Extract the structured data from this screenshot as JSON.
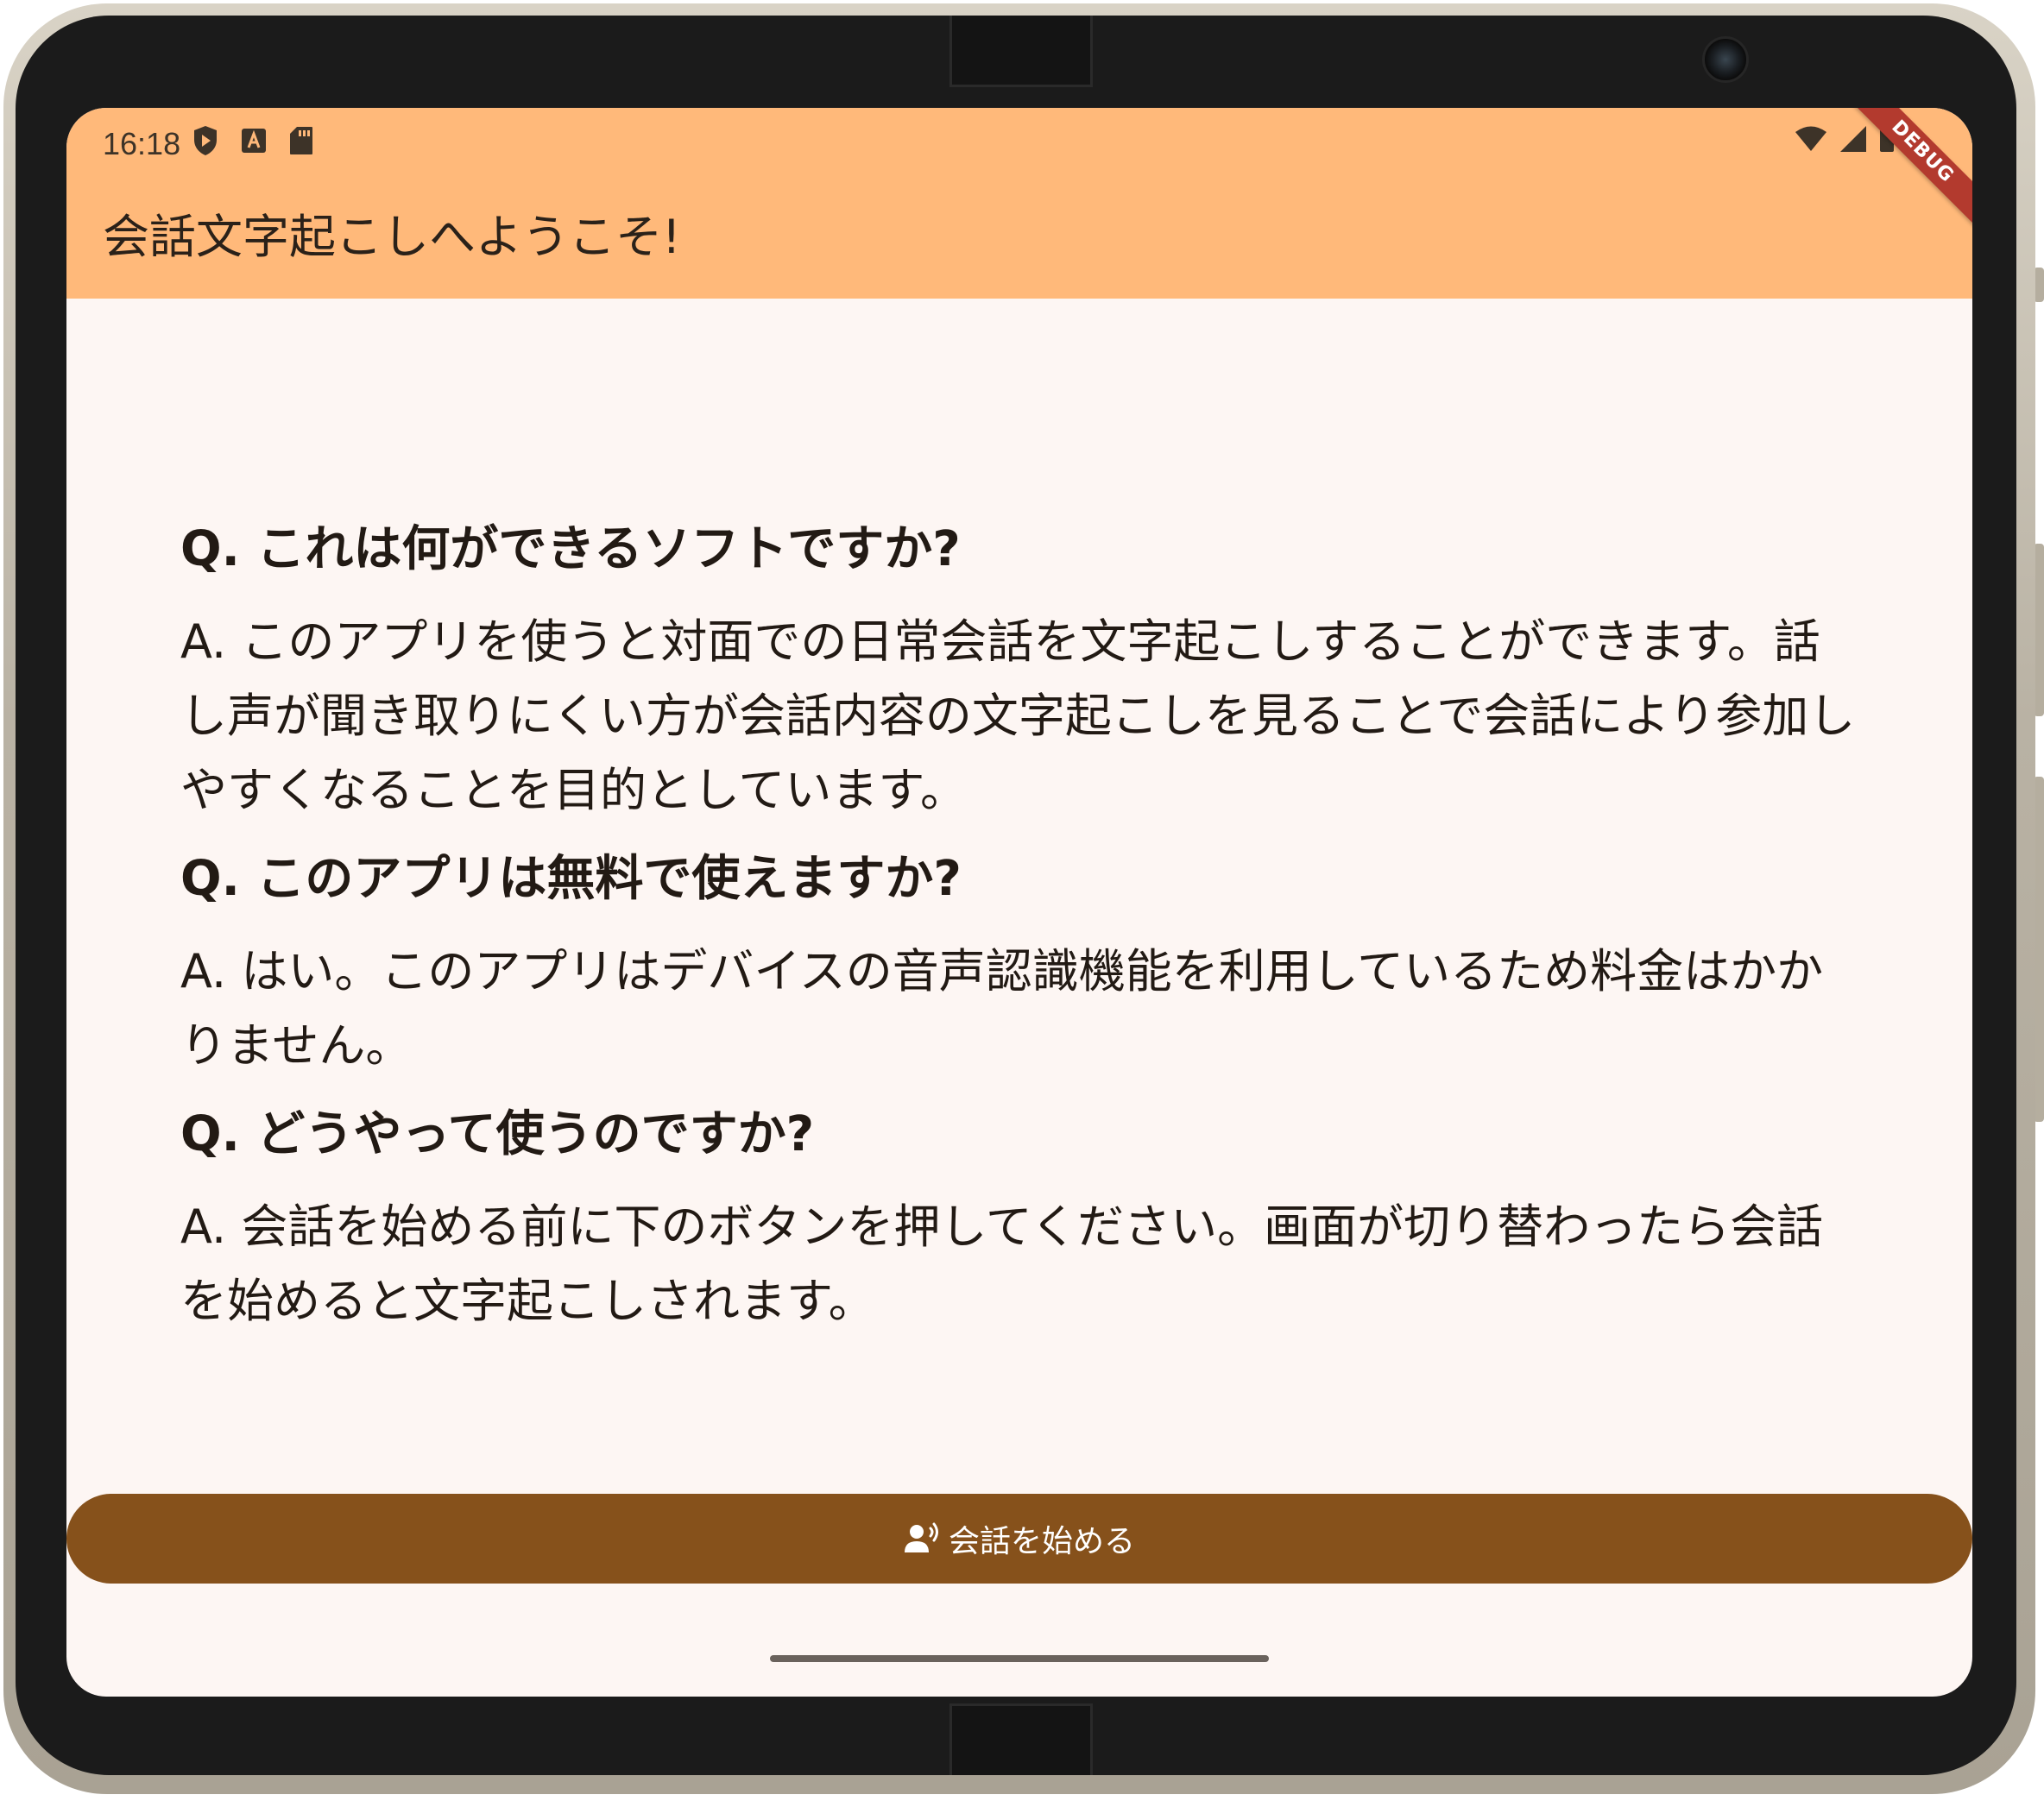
{
  "status_bar": {
    "time": "16:18",
    "left_icons": [
      "play-protect-icon",
      "app-a-icon",
      "sd-card-icon"
    ],
    "right_icons": [
      "wifi-icon",
      "signal-icon",
      "battery-icon"
    ]
  },
  "appbar": {
    "title": "会話文字起こしへようこそ!",
    "background": "#ffb97a"
  },
  "debug_banner": "DEBUG",
  "faq": [
    {
      "question": "Q. これは何ができるソフトですか?",
      "answer": "A. このアプリを使うと対面での日常会話を文字起こしすることができます。話し声が聞き取りにくい方が会話内容の文字起こしを見ることで会話により参加しやすくなることを目的としています。"
    },
    {
      "question": "Q. このアプリは無料で使えますか?",
      "answer": "A. はい。このアプリはデバイスの音声認識機能を利用しているため料金はかかりません。"
    },
    {
      "question": "Q. どうやって使うのですか?",
      "answer": "A. 会話を始める前に下のボタンを押してください。画面が切り替わったら会話を始めると文字起こしされます。"
    }
  ],
  "start_button": {
    "label": "会話を始める",
    "icon": "record-voice-icon",
    "color": "#86511b"
  },
  "colors": {
    "screen_background": "#fdf6f3",
    "text": "#221a14"
  }
}
